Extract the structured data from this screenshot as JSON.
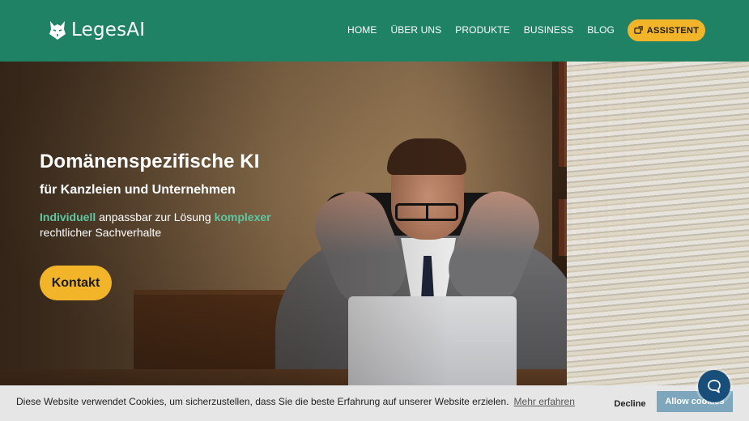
{
  "header": {
    "logo_text": "LegesAI",
    "nav": [
      {
        "label": "HOME"
      },
      {
        "label": "ÜBER UNS"
      },
      {
        "label": "PRODUKTE"
      },
      {
        "label": "BUSINESS"
      },
      {
        "label": "BLOG"
      }
    ],
    "assistant_label": "ASSISTENT",
    "assistant_icon": "assistant-icon",
    "brand_color": "#1f8264",
    "accent_color": "#f2b52a"
  },
  "hero": {
    "title": "Domänenspezifische KI",
    "subtitle": "für Kanzleien und Unternehmen",
    "desc_hl1": "Individuell",
    "desc_mid": " anpassbar zur Lösung ",
    "desc_hl2": "komplexer",
    "desc_end": " rechtlicher Sachverhalte",
    "contact_label": "Kontakt",
    "image_description": "stressed man at desk with laptop and paper stacks"
  },
  "cookie": {
    "text": "Diese Website verwendet Cookies, um sicherzustellen, dass Sie die beste Erfahrung auf unserer Website erzielen.",
    "link": "Mehr erfahren",
    "decline": "Decline",
    "allow": "Allow cookies"
  },
  "chat": {
    "icon": "chat-icon"
  }
}
